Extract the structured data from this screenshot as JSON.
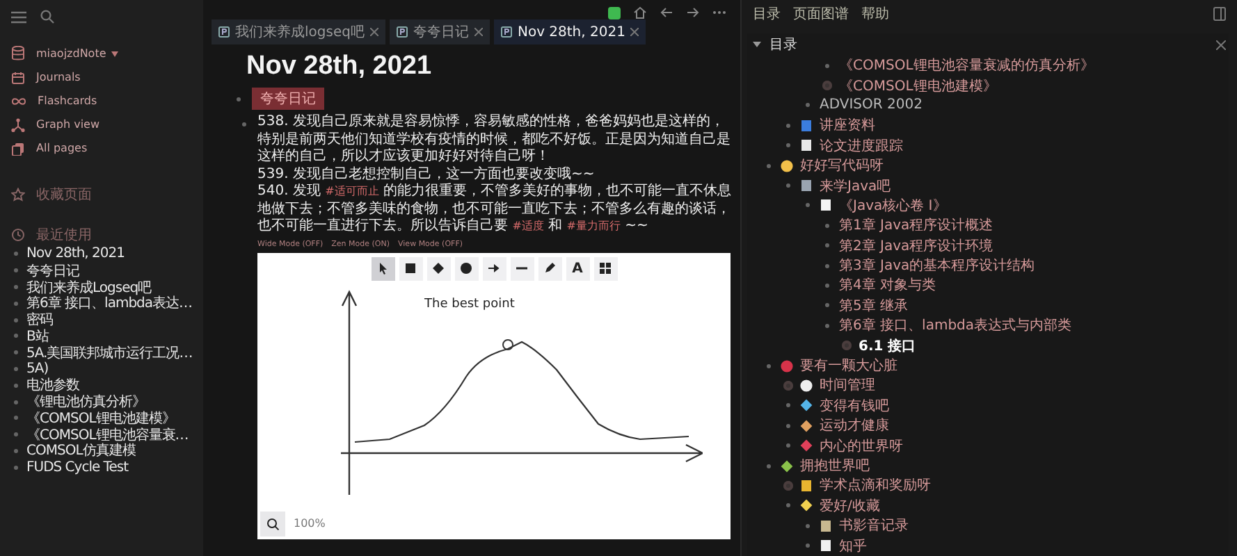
{
  "sidebar": {
    "graph_name": "miaojzdNote",
    "nav": [
      {
        "kind": "journals",
        "label": "Journals"
      },
      {
        "kind": "flashcards",
        "label": "Flashcards"
      },
      {
        "kind": "graph",
        "label": "Graph view"
      },
      {
        "kind": "pages",
        "label": "All pages"
      }
    ],
    "favorites_heading": "收藏页面",
    "recent_heading": "最近使用",
    "recent": [
      "Nov 28th, 2021",
      "夸夸日记",
      "我们来养成Logseq吧",
      "第6章 接口、lambda表达…",
      "密码",
      "B站",
      "5A.美国联邦城市运行工况…",
      "5A)",
      "电池参数",
      "《锂电池仿真分析》",
      "《COMSOL锂电池建模》",
      "《COMSOL锂电池容量衰…",
      "COMSOL仿真建模",
      "FUDS Cycle Test"
    ]
  },
  "tabs": [
    {
      "label": "我们来养成logseq吧",
      "selected": false
    },
    {
      "label": "夸夸日记",
      "selected": false
    },
    {
      "label": "Nov 28th, 2021",
      "selected": true
    }
  ],
  "page": {
    "title": "Nov 28th, 2021",
    "tag": "夸夸日记",
    "lines": [
      [
        {
          "kind": "text",
          "text": "538. 发现自己原来就是容易惊悸，容易敏感的性格，爸爸妈妈也是这样的，特别是前两天他们知道学校有疫情的时候，都吃不好饭。正是因为知道自己是这样的自己，所以才应该更加好好对待自己呀！"
        }
      ],
      [
        {
          "kind": "text",
          "text": "539. 发现自己老想控制自己，这一方面也要改变哦~~"
        }
      ],
      [
        {
          "kind": "text",
          "text": "540. 发现 "
        },
        {
          "kind": "tag",
          "text": "#适可而止"
        },
        {
          "kind": "text",
          "text": " 的能力很重要，不管多美好的事物，也不可能一直不休息地做下去；不管多美味的食物，也不可能一直吃下去；不管多么有趣的谈话，也不可能一直进行下去。所以告诉自己要 "
        },
        {
          "kind": "tag",
          "text": "#适度"
        },
        {
          "kind": "text",
          "text": " 和 "
        },
        {
          "kind": "tag",
          "text": "#量力而行"
        },
        {
          "kind": "text",
          "text": " ~~"
        }
      ]
    ],
    "modes": [
      "Wide Mode (OFF)",
      "Zen Mode (ON)",
      "View Mode (OFF)"
    ],
    "canvas": {
      "tools": [
        {
          "kind": "select",
          "selected": true
        },
        {
          "kind": "rectangle",
          "selected": false
        },
        {
          "kind": "diamond",
          "selected": false
        },
        {
          "kind": "ellipse",
          "selected": false
        },
        {
          "kind": "arrow",
          "selected": false
        },
        {
          "kind": "line",
          "selected": false
        },
        {
          "kind": "pencil",
          "selected": false
        },
        {
          "kind": "text",
          "glyph": "A",
          "selected": false
        },
        {
          "kind": "library",
          "selected": false
        }
      ],
      "note": "The best point",
      "zoom": "100%"
    }
  },
  "right": {
    "menu": [
      "目录",
      "页面图谱",
      "帮助"
    ],
    "heading": "目录",
    "expanded": true,
    "items": [
      {
        "children": [
          {
            "children": [
              {
                "children": [
                  {
                    "label": "《COMSOL锂电池容量衰减的仿真分析》",
                    "collapsed": false
                  },
                  {
                    "label": "《COMSOL锂电池建模》",
                    "collapsed": true
                  }
                ]
              },
              {
                "label": "ADVISOR 2002",
                "collapsed": false,
                "plain": true
              }
            ]
          },
          {
            "label": "讲座资料",
            "kind": "book",
            "collapsed": false
          },
          {
            "label": "论文进度跟踪",
            "kind": "calendar",
            "collapsed": false
          }
        ]
      },
      {
        "label": "好好写代码呀",
        "kind": "smiley",
        "collapsed": false,
        "children": [
          {
            "label": "来学Java吧",
            "kind": "laptop",
            "collapsed": false,
            "children": [
              {
                "label": "《Java核心卷 I》",
                "kind": "card",
                "collapsed": false,
                "children": [
                  {
                    "label": "第1章 Java程序设计概述",
                    "collapsed": false
                  },
                  {
                    "label": "第2章 Java程序设计环境",
                    "collapsed": false
                  },
                  {
                    "label": "第3章 Java的基本程序设计结构",
                    "collapsed": false
                  },
                  {
                    "label": "第4章 对象与类",
                    "collapsed": false
                  },
                  {
                    "label": "第5章 继承",
                    "collapsed": false
                  },
                  {
                    "label": "第6章 接口、lambda表达式与内部类",
                    "collapsed": false,
                    "children": [
                      {
                        "label": "6.1 接口",
                        "collapsed": true,
                        "current": true
                      }
                    ]
                  }
                ]
              }
            ]
          }
        ]
      },
      {
        "label": "要有一颗大心脏",
        "kind": "lips",
        "collapsed": false,
        "children": [
          {
            "label": "时间管理",
            "kind": "clock",
            "collapsed": true
          },
          {
            "label": "变得有钱吧",
            "kind": "gem",
            "collapsed": false
          },
          {
            "label": "运动才健康",
            "kind": "runner",
            "collapsed": false
          },
          {
            "label": "内心的世界呀",
            "kind": "heart",
            "collapsed": false
          }
        ]
      },
      {
        "label": "拥抱世界吧",
        "kind": "sprout",
        "collapsed": false,
        "children": [
          {
            "label": "学术点滴和奖励呀",
            "kind": "trophy",
            "collapsed": true
          },
          {
            "label": "爱好/收藏",
            "kind": "sparkle",
            "collapsed": false,
            "children": [
              {
                "label": "书影音记录",
                "kind": "notebook",
                "collapsed": false
              },
              {
                "label": "知乎",
                "kind": "speech",
                "collapsed": false
              }
            ]
          }
        ]
      }
    ]
  }
}
